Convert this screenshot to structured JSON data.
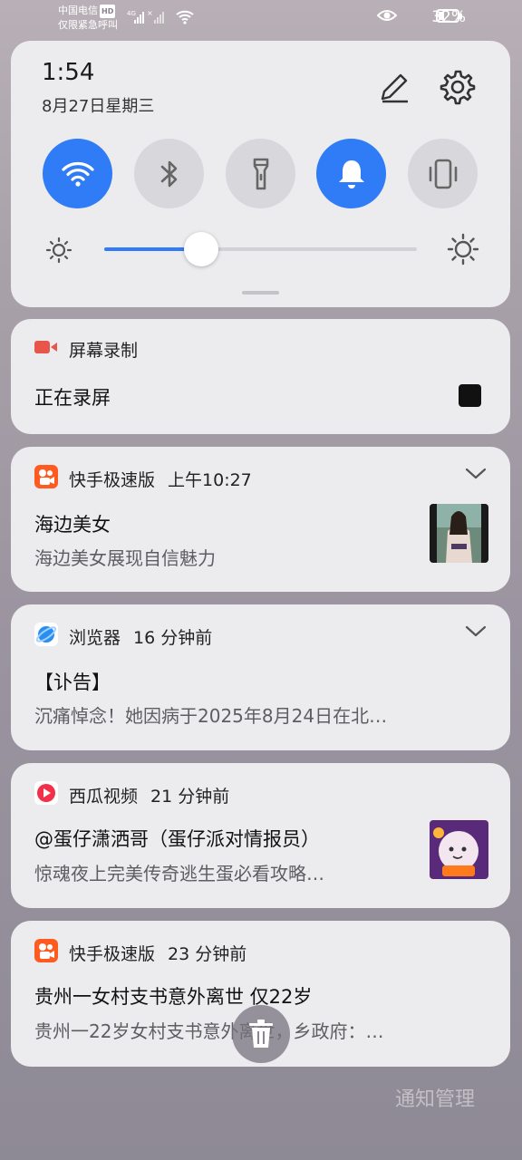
{
  "status_bar": {
    "carrier_line1": "中国电信",
    "carrier_hd": "HD",
    "carrier_line2": "仅限紧急呼叫",
    "network": "4G",
    "battery_text": "32%",
    "battery_level": 0.32
  },
  "quick_settings": {
    "time": "1:54",
    "date": "8月27日星期三",
    "brightness_level": 0.31,
    "tiles": [
      {
        "name": "wifi",
        "on": true
      },
      {
        "name": "bluetooth",
        "on": false
      },
      {
        "name": "flashlight",
        "on": false
      },
      {
        "name": "sound",
        "on": true
      },
      {
        "name": "vibrate",
        "on": false
      }
    ],
    "accent_color": "#2f7cf6"
  },
  "notifications": [
    {
      "app": "屏幕录制",
      "title": "正在录屏",
      "icon": "screen-record-icon",
      "icon_color": "#e8554b"
    },
    {
      "app": "快手极速版",
      "time": "上午10:27",
      "title": "海边美女",
      "subtitle": "海边美女展现自信魅力",
      "icon": "kuaishou-icon"
    },
    {
      "app": "浏览器",
      "time": "16 分钟前",
      "title": "【讣告】",
      "subtitle": "沉痛悼念！她因病于2025年8月24日在北…",
      "icon": "browser-icon"
    },
    {
      "app": "西瓜视频",
      "time": "21 分钟前",
      "title": "@蛋仔潇洒哥（蛋仔派对情报员）",
      "subtitle": "惊魂夜上完美传奇逃生蛋必看攻略…",
      "icon": "xigua-icon"
    },
    {
      "app": "快手极速版",
      "time": "23 分钟前",
      "title": "贵州一女村支书意外离世 仅22岁",
      "subtitle": "贵州一22岁女村支书意外离世，乡政府：…",
      "icon": "kuaishou-icon"
    }
  ],
  "footer": {
    "manage_label": "通知管理"
  }
}
